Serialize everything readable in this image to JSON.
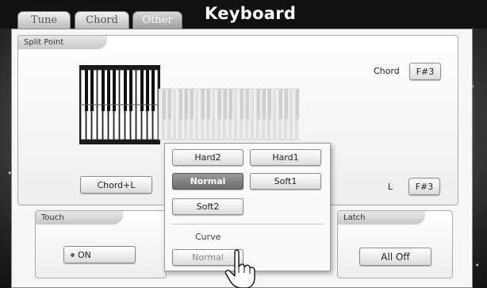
{
  "tabs": [
    {
      "label": "Tune",
      "active": false
    },
    {
      "label": "Chord",
      "active": false
    },
    {
      "label": "Other",
      "active": true
    }
  ],
  "title": "Keyboard",
  "split_point": {
    "label": "Split Point",
    "chord_label": "Chord",
    "chord_value": "F#3",
    "l_label": "L",
    "l_value": "F#3",
    "mode_button": "Chord+L"
  },
  "touch": {
    "label": "Touch",
    "on_button": "ON"
  },
  "latch": {
    "label": "Latch",
    "button": "All Off"
  },
  "popup": {
    "options": [
      "Hard2",
      "Hard1",
      "Normal",
      "Soft1",
      "Soft2"
    ],
    "selected": "Normal",
    "curve_label": "Curve",
    "curve_value": "Normal"
  },
  "colors": {
    "background": "#5a5a5a",
    "titlebar": "#111111",
    "selected_button": "#7a7a7a"
  },
  "icons": {
    "keyboard": "piano-keyboard-icon",
    "pointer": "hand-pointer-icon",
    "indicator": "dot-icon"
  }
}
